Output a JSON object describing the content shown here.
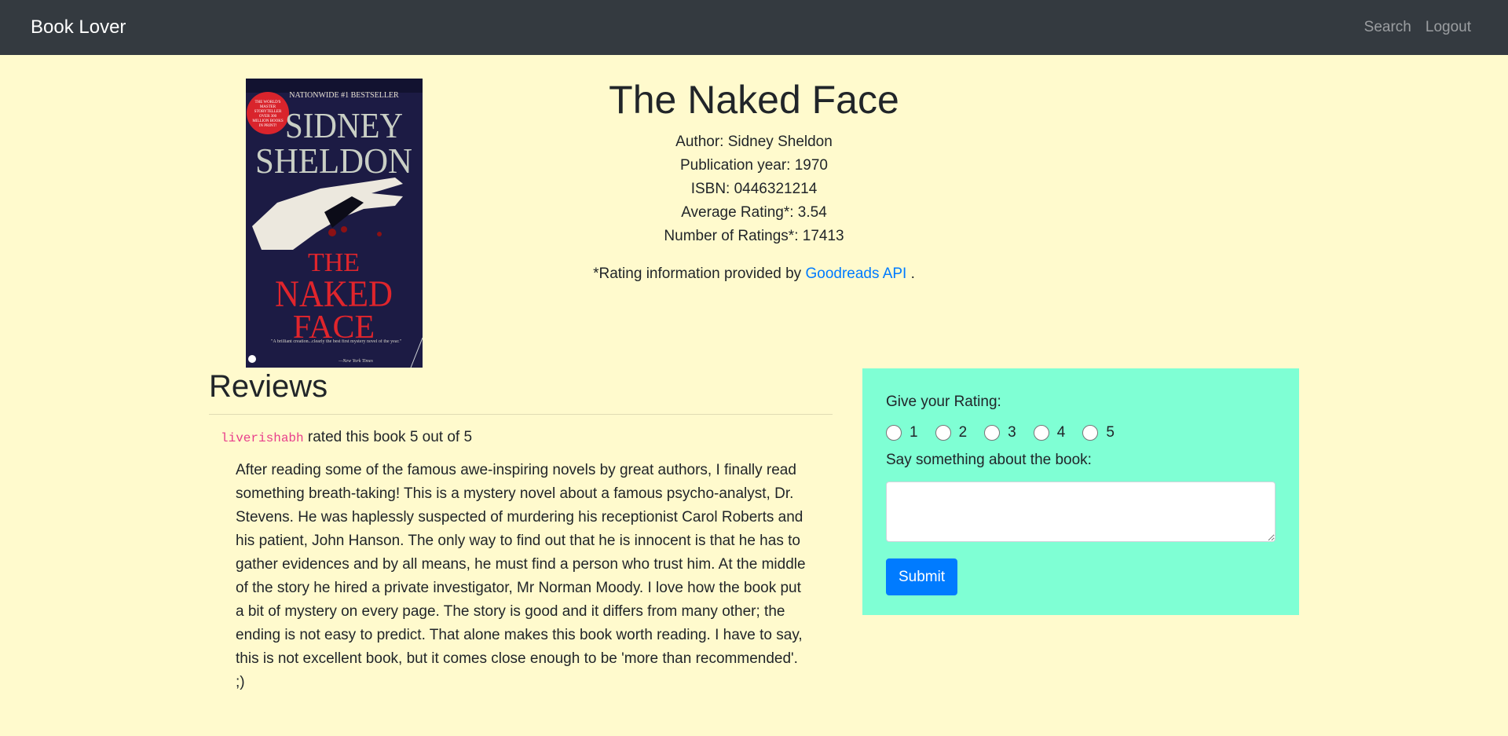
{
  "navbar": {
    "brand": "Book Lover",
    "links": [
      "Search",
      "Logout"
    ]
  },
  "book": {
    "cover": {
      "top_banner": "NATIONWIDE #1 BESTSELLER",
      "badge": "THE WORLD'S MASTER STORYTELLER OVER 300 MILLION BOOKS IN PRINT!",
      "author_line1": "SIDNEY",
      "author_line2": "SHELDON",
      "title_line1": "THE",
      "title_line2": "NAKED",
      "title_line3": "FACE",
      "blurb": "\"A brilliant creation...clearly the best first mystery novel of the year.\"",
      "blurb_source": "—New York Times"
    },
    "title": "The Naked Face",
    "author": "Author: Sidney Sheldon",
    "publication_year": "Publication year: 1970",
    "isbn": "ISBN: 0446321214",
    "average_rating": "Average Rating*: 3.54",
    "number_of_ratings": "Number of Ratings*: 17413",
    "credit_prefix": "*Rating information provided by",
    "credit_link": "Goodreads API",
    "credit_suffix": "."
  },
  "reviews": {
    "heading": "Reviews",
    "items": [
      {
        "username": "liverishabh",
        "rating_text": " rated this book 5 out of 5",
        "body": "After reading some of the famous awe-inspiring novels by great authors, I finally read something breath-taking! This is a mystery novel about a famous psycho-analyst, Dr. Stevens. He was haplessly suspected of murdering his receptionist Carol Roberts and his patient, John Hanson. The only way to find out that he is innocent is that he has to gather evidences and by all means, he must find a person who trust him. At the middle of the story he hired a private investigator, Mr Norman Moody. I love how the book put a bit of mystery on every page. The story is good and it differs from many other; the ending is not easy to predict. That alone makes this book worth reading. I have to say, this is not excellent book, but it comes close enough to be 'more than recommended'. ;)"
      }
    ]
  },
  "rating_form": {
    "rating_label": "Give your Rating:",
    "options": [
      "1",
      "2",
      "3",
      "4",
      "5"
    ],
    "comment_label": "Say something about the book:",
    "comment_value": "",
    "submit_label": "Submit"
  }
}
